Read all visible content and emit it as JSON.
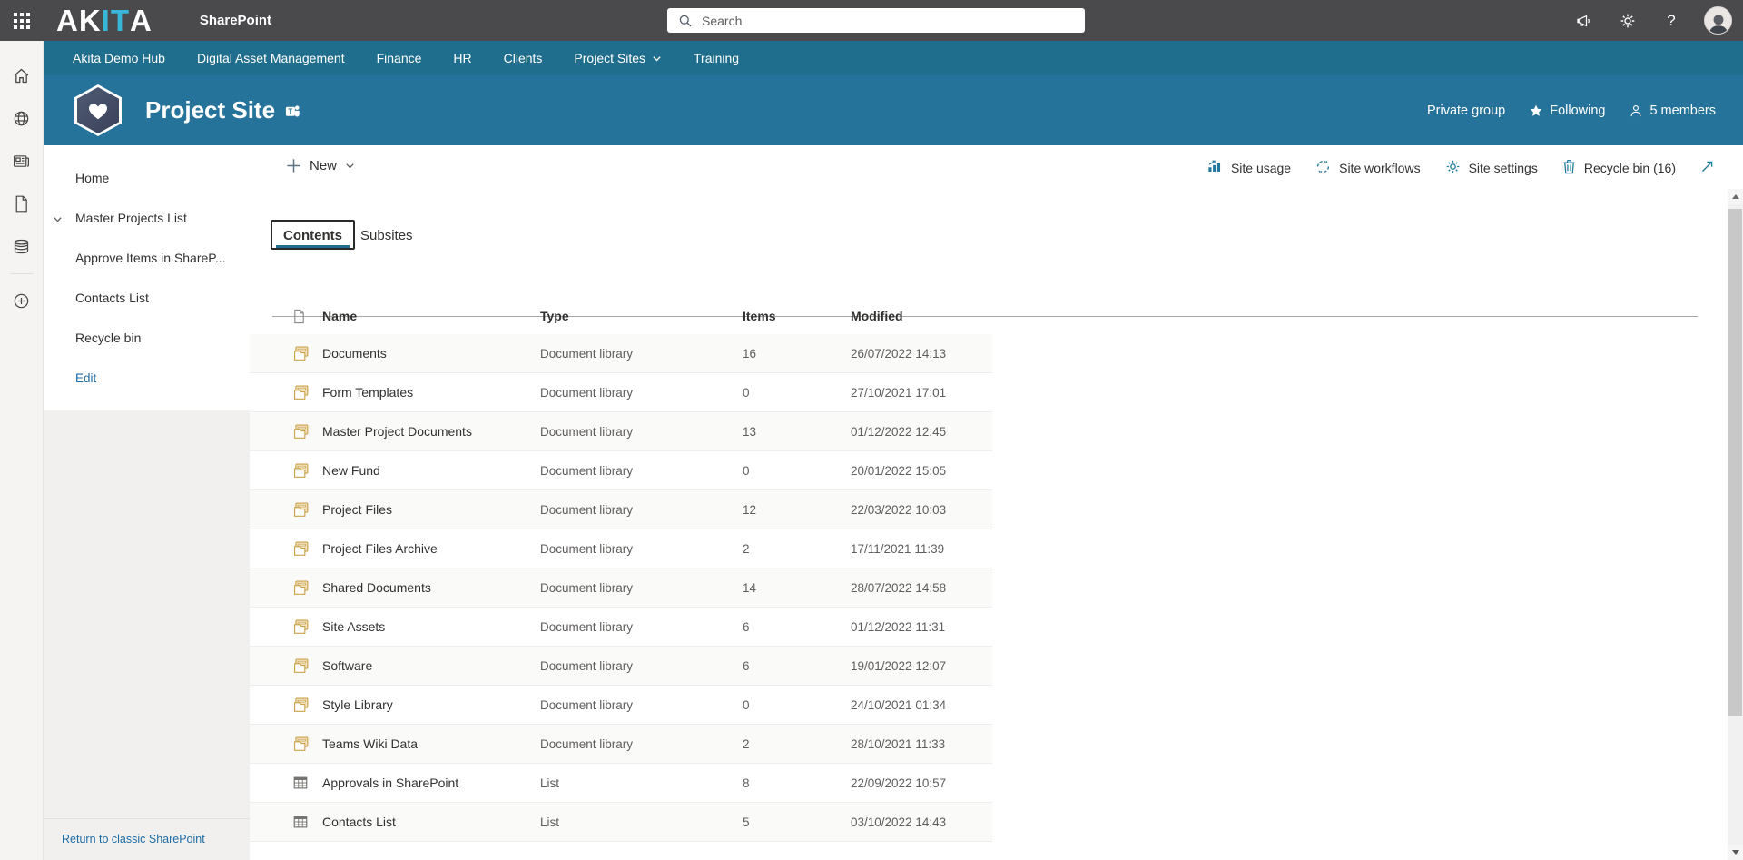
{
  "colors": {
    "topbar": "#4a4a4d",
    "teal_nav": "#206e8d",
    "teal_header": "#25739a",
    "accent": "#206e8d",
    "link_blue": "#1f6ba5",
    "library_gold": "#caa24a"
  },
  "topbar": {
    "logo_part1": "AK",
    "logo_part2": "IT",
    "logo_part3": "A",
    "app_name": "SharePoint",
    "search": {
      "placeholder": "Search"
    },
    "icons": [
      "announcements-icon",
      "settings-icon",
      "help-icon",
      "account-avatar"
    ],
    "help_label": "?"
  },
  "rail": {
    "icons": [
      "home-icon",
      "globe-icon",
      "news-icon",
      "document-icon",
      "lists-icon",
      "add-icon"
    ]
  },
  "hubnav": {
    "items": [
      {
        "label": "Akita Demo Hub",
        "has_dropdown": false
      },
      {
        "label": "Digital Asset Management",
        "has_dropdown": false
      },
      {
        "label": "Finance",
        "has_dropdown": false
      },
      {
        "label": "HR",
        "has_dropdown": false
      },
      {
        "label": "Clients",
        "has_dropdown": false
      },
      {
        "label": "Project Sites",
        "has_dropdown": true
      },
      {
        "label": "Training",
        "has_dropdown": false
      }
    ]
  },
  "site_header": {
    "title": "Project Site",
    "privacy": "Private group",
    "following": "Following",
    "members": "5 members"
  },
  "sidebar": {
    "items": [
      {
        "label": "Home",
        "chevron": false,
        "link_style": false
      },
      {
        "label": "Master Projects List",
        "chevron": true,
        "link_style": false
      },
      {
        "label": "Approve Items in ShareP...",
        "chevron": false,
        "link_style": false
      },
      {
        "label": "Contacts List",
        "chevron": false,
        "link_style": false
      },
      {
        "label": "Recycle bin",
        "chevron": false,
        "link_style": false
      },
      {
        "label": "Edit",
        "chevron": false,
        "link_style": true
      }
    ],
    "footer_link": "Return to classic SharePoint"
  },
  "command_bar": {
    "new_label": "New",
    "actions": [
      {
        "icon": "site-usage-icon",
        "label": "Site usage"
      },
      {
        "icon": "site-workflows-icon",
        "label": "Site workflows"
      },
      {
        "icon": "site-settings-icon",
        "label": "Site settings"
      },
      {
        "icon": "recycle-bin-icon",
        "label": "Recycle bin (16)"
      },
      {
        "icon": "expand-icon",
        "label": ""
      }
    ]
  },
  "tabs": {
    "contents": "Contents",
    "subsites": "Subsites"
  },
  "table": {
    "columns": [
      "Name",
      "Type",
      "Items",
      "Modified"
    ],
    "rows": [
      {
        "icon": "document-library-icon",
        "name": "Documents",
        "type": "Document library",
        "items": "16",
        "modified": "26/07/2022 14:13"
      },
      {
        "icon": "document-library-icon",
        "name": "Form Templates",
        "type": "Document library",
        "items": "0",
        "modified": "27/10/2021 17:01"
      },
      {
        "icon": "document-library-icon",
        "name": "Master Project Documents",
        "type": "Document library",
        "items": "13",
        "modified": "01/12/2022 12:45"
      },
      {
        "icon": "document-library-icon",
        "name": "New Fund",
        "type": "Document library",
        "items": "0",
        "modified": "20/01/2022 15:05"
      },
      {
        "icon": "document-library-icon",
        "name": "Project Files",
        "type": "Document library",
        "items": "12",
        "modified": "22/03/2022 10:03"
      },
      {
        "icon": "document-library-icon",
        "name": "Project Files Archive",
        "type": "Document library",
        "items": "2",
        "modified": "17/11/2021 11:39"
      },
      {
        "icon": "document-library-icon",
        "name": "Shared Documents",
        "type": "Document library",
        "items": "14",
        "modified": "28/07/2022 14:58"
      },
      {
        "icon": "document-library-icon",
        "name": "Site Assets",
        "type": "Document library",
        "items": "6",
        "modified": "01/12/2022 11:31"
      },
      {
        "icon": "document-library-icon",
        "name": "Software",
        "type": "Document library",
        "items": "6",
        "modified": "19/01/2022 12:07"
      },
      {
        "icon": "document-library-icon",
        "name": "Style Library",
        "type": "Document library",
        "items": "0",
        "modified": "24/10/2021 01:34"
      },
      {
        "icon": "document-library-icon",
        "name": "Teams Wiki Data",
        "type": "Document library",
        "items": "2",
        "modified": "28/10/2021 11:33"
      },
      {
        "icon": "list-icon",
        "name": "Approvals in SharePoint",
        "type": "List",
        "items": "8",
        "modified": "22/09/2022 10:57"
      },
      {
        "icon": "list-icon",
        "name": "Contacts List",
        "type": "List",
        "items": "5",
        "modified": "03/10/2022 14:43"
      }
    ]
  }
}
